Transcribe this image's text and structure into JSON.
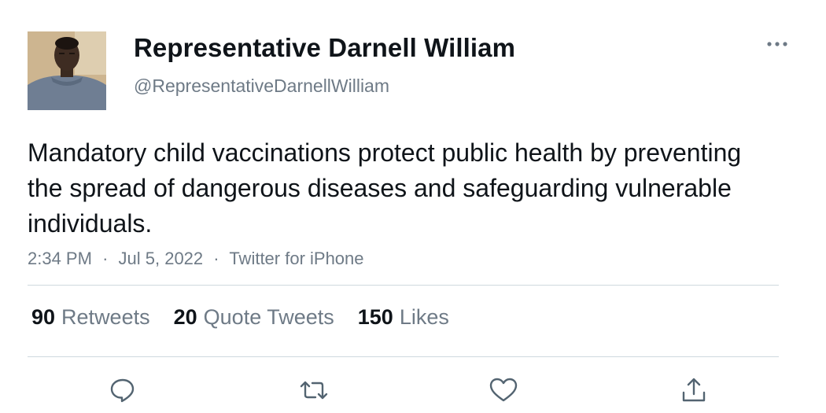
{
  "author": {
    "display_name": "Representative Darnell William",
    "handle": "@RepresentativeDarnellWilliam"
  },
  "tweet": {
    "text": "Mandatory child vaccinations protect public health by preventing the spread of dangerous diseases and safeguarding vulnerable individuals.",
    "time": "2:34 PM",
    "separator": "·",
    "date": "Jul 5, 2022",
    "source": "Twitter for iPhone"
  },
  "stats": {
    "retweets_count": "90",
    "retweets_label": "Retweets",
    "quote_tweets_count": "20",
    "quote_tweets_label": "Quote Tweets",
    "likes_count": "150",
    "likes_label": "Likes"
  },
  "icons": {
    "more": "more-horizontal-icon",
    "reply": "reply-icon",
    "retweet": "retweet-icon",
    "like": "heart-icon",
    "share": "share-icon"
  },
  "colors": {
    "text": "#0f1419",
    "secondary": "#6e7a86",
    "divider": "#cfd9de"
  }
}
